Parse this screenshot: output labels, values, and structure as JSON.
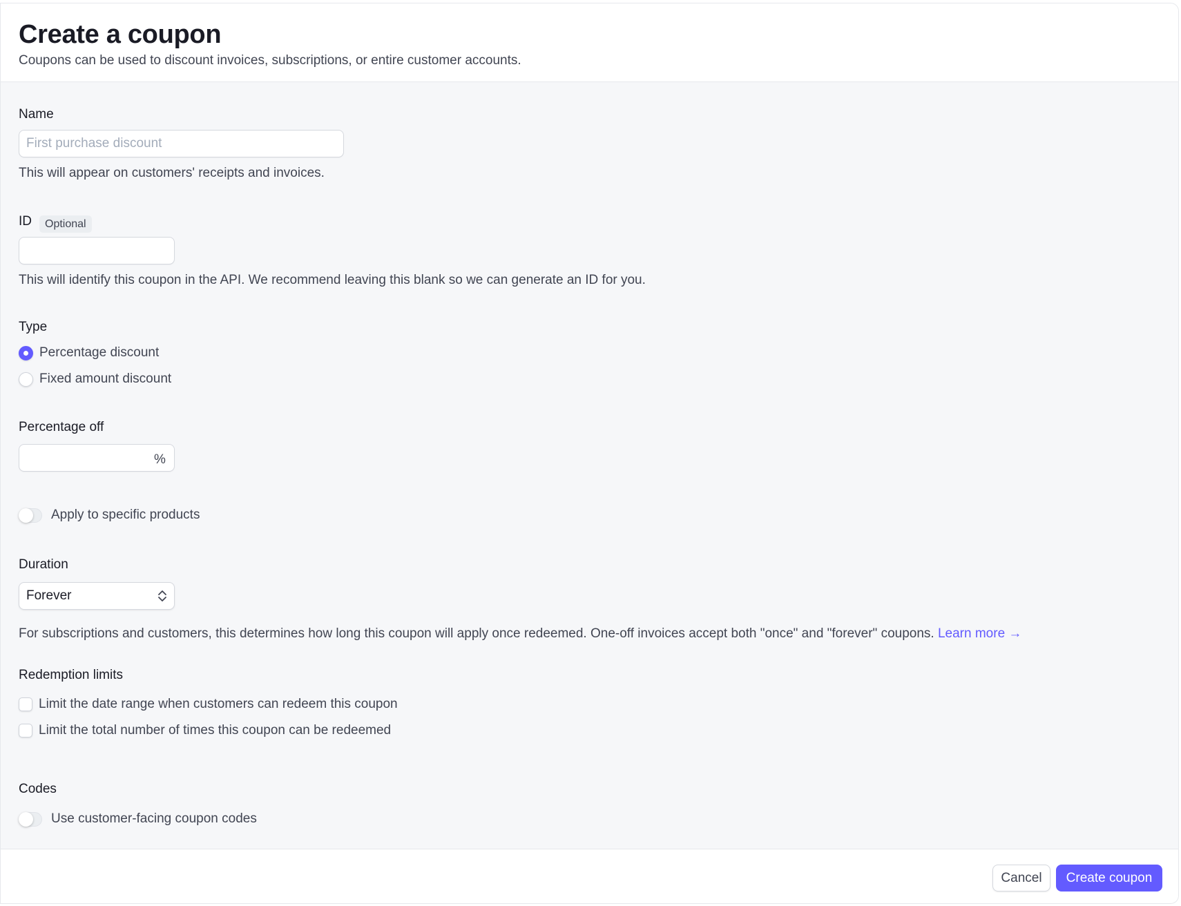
{
  "header": {
    "title": "Create a coupon",
    "subtitle": "Coupons can be used to discount invoices, subscriptions, or entire customer accounts."
  },
  "name_field": {
    "label": "Name",
    "placeholder": "First purchase discount",
    "value": "",
    "help": "This will appear on customers' receipts and invoices."
  },
  "id_field": {
    "label": "ID",
    "badge": "Optional",
    "value": "",
    "help": "This will identify this coupon in the API. We recommend leaving this blank so we can generate an ID for you."
  },
  "type": {
    "label": "Type",
    "options": [
      {
        "label": "Percentage discount",
        "checked": true
      },
      {
        "label": "Fixed amount discount",
        "checked": false
      }
    ]
  },
  "percentage_off": {
    "label": "Percentage off",
    "value": "",
    "suffix": "%"
  },
  "apply_products": {
    "label": "Apply to specific products",
    "enabled": false
  },
  "duration": {
    "label": "Duration",
    "selected": "Forever",
    "help": "For subscriptions and customers, this determines how long this coupon will apply once redeemed. One-off invoices accept both \"once\" and \"forever\" coupons.",
    "learn_more": "Learn more →"
  },
  "redemption_limits": {
    "label": "Redemption limits",
    "options": [
      {
        "label": "Limit the date range when customers can redeem this coupon",
        "checked": false
      },
      {
        "label": "Limit the total number of times this coupon can be redeemed",
        "checked": false
      }
    ]
  },
  "codes": {
    "label": "Codes",
    "toggle_label": "Use customer-facing coupon codes",
    "enabled": false
  },
  "footer": {
    "cancel_label": "Cancel",
    "create_label": "Create coupon"
  },
  "colors": {
    "accent": "#635bff",
    "background": "#f6f7f9",
    "text": "#1a1b25",
    "muted_text": "#414552"
  }
}
